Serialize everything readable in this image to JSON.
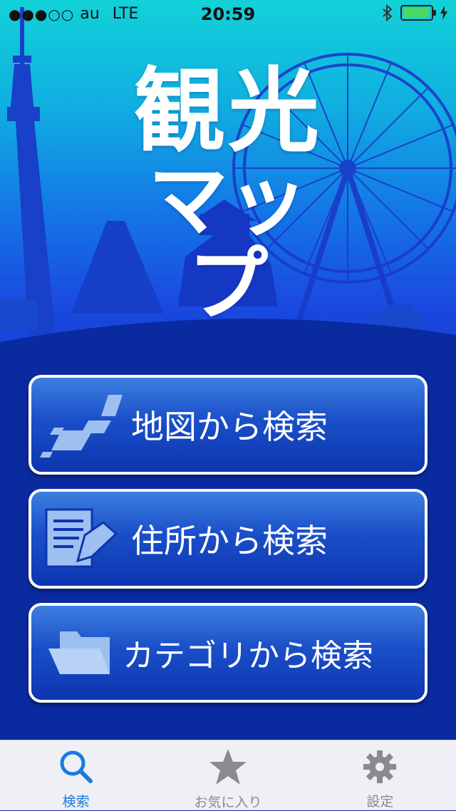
{
  "status_bar": {
    "signal": "●●●○○",
    "carrier": "au",
    "network": "LTE",
    "time": "20:59",
    "bluetooth_icon": "bluetooth-icon",
    "battery_level": 0.95,
    "battery_color": "#4cd964"
  },
  "app": {
    "title_line1": "観光",
    "title_line2": "マップ"
  },
  "buttons": {
    "map_search": {
      "label": "地図から検索",
      "icon": "japan-map-icon"
    },
    "address_search": {
      "label": "住所から検索",
      "icon": "document-pencil-icon"
    },
    "category_search": {
      "label": "カテゴリから検索",
      "icon": "folder-icon"
    }
  },
  "tab_bar": {
    "tabs": [
      {
        "label": "検索",
        "icon": "search-icon",
        "active": true
      },
      {
        "label": "お気に入り",
        "icon": "star-icon",
        "active": false
      },
      {
        "label": "設定",
        "icon": "gear-icon",
        "active": false
      }
    ]
  },
  "colors": {
    "accent": "#1a7ae0",
    "background": "#0a2aa0",
    "inactive_tab": "#8a8a8f"
  }
}
